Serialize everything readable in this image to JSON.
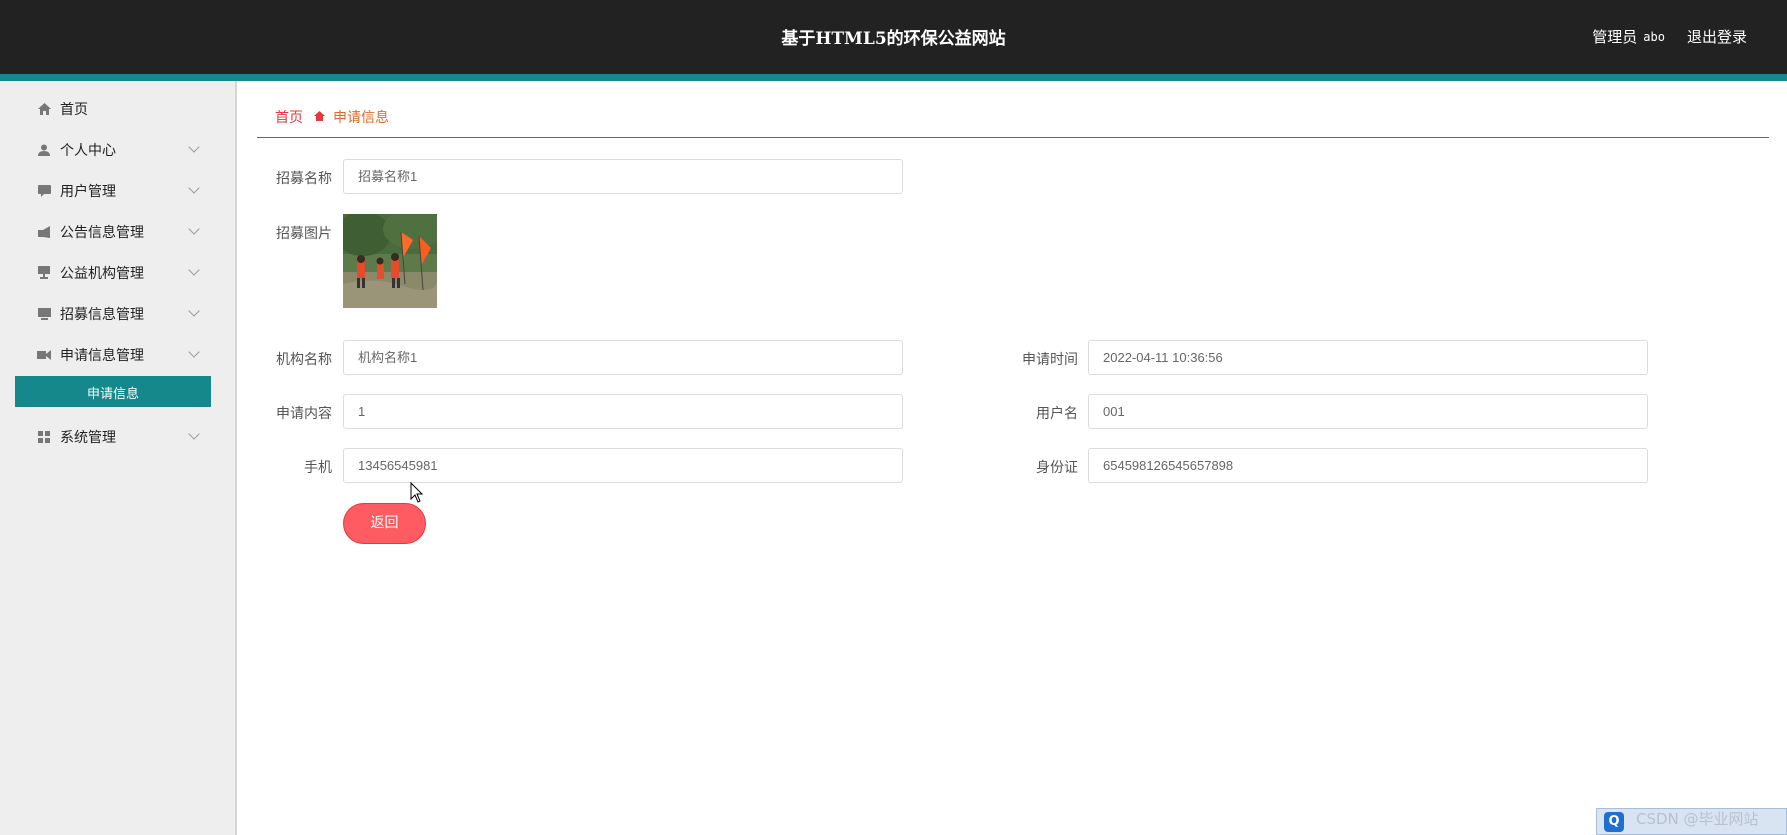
{
  "header": {
    "title": "基于HTML5的环保公益网站",
    "user_role": "管理员",
    "user_name": "abo",
    "logout_label": "退出登录"
  },
  "sidebar": {
    "items": [
      {
        "label": "首页",
        "icon": "home-icon",
        "has_children": false
      },
      {
        "label": "个人中心",
        "icon": "user-icon",
        "has_children": true
      },
      {
        "label": "用户管理",
        "icon": "chat-icon",
        "has_children": true
      },
      {
        "label": "公告信息管理",
        "icon": "megaphone-icon",
        "has_children": true
      },
      {
        "label": "公益机构管理",
        "icon": "monitor-icon",
        "has_children": true
      },
      {
        "label": "招募信息管理",
        "icon": "screen-icon",
        "has_children": true
      },
      {
        "label": "申请信息管理",
        "icon": "video-icon",
        "has_children": true
      },
      {
        "label": "系统管理",
        "icon": "grid-icon",
        "has_children": true
      }
    ],
    "active_subitem": "申请信息"
  },
  "breadcrumb": {
    "home": "首页",
    "current": "申请信息"
  },
  "form": {
    "recruit_name_label": "招募名称",
    "recruit_name_value": "招募名称1",
    "recruit_image_label": "招募图片",
    "org_name_label": "机构名称",
    "org_name_value": "机构名称1",
    "apply_time_label": "申请时间",
    "apply_time_value": "2022-04-11 10:36:56",
    "apply_content_label": "申请内容",
    "apply_content_value": "1",
    "username_label": "用户名",
    "username_value": "001",
    "phone_label": "手机",
    "phone_value": "13456545981",
    "id_card_label": "身份证",
    "id_card_value": "654598126545657898",
    "back_button": "返回"
  },
  "watermark": "CSDN @毕业网站",
  "colors": {
    "header_bg": "#222222",
    "accent": "#14888a",
    "button": "#ff5b62",
    "breadcrumb_home": "#e8383d"
  }
}
